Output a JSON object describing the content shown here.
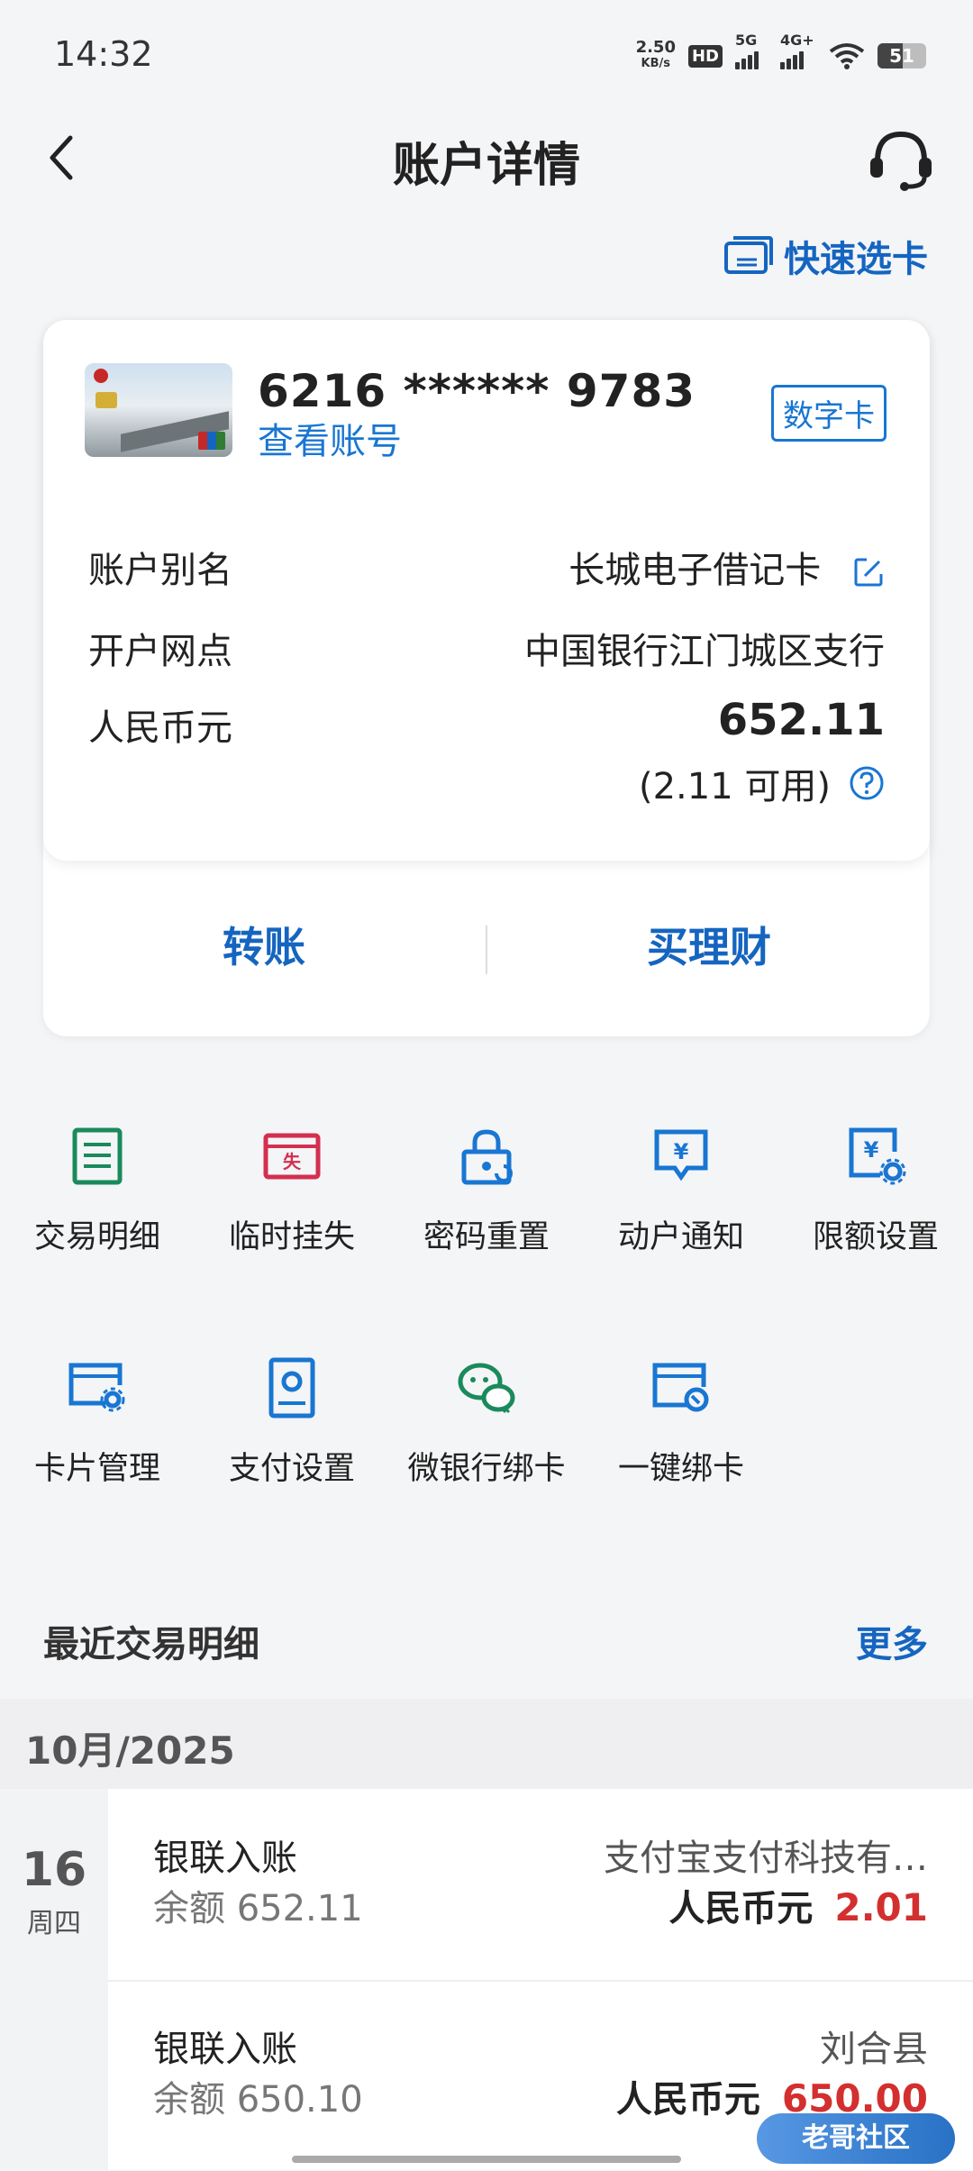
{
  "status_bar": {
    "time": "14:32",
    "net_speed_value": "2.50",
    "net_speed_unit": "KB/s",
    "hd_label": "HD",
    "signal1_label": "5G",
    "signal2_label": "4G+",
    "battery": "51",
    "battery_level": 0.51
  },
  "header": {
    "title": "账户详情",
    "back_icon": "chevron-left-icon",
    "service_icon": "headset-icon"
  },
  "quick_select": {
    "label": "快速选卡",
    "icon": "card-switch-icon"
  },
  "card": {
    "number": "6216 ****** 9783",
    "view_account": "查看账号",
    "badge": "数字卡",
    "alias_label": "账户别名",
    "alias_value": "长城电子借记卡",
    "branch_label": "开户网点",
    "branch_value": "中国银行江门城区支行",
    "currency_label": "人民币元",
    "balance": "652.11",
    "available": "(2.11 可用)"
  },
  "actions": {
    "transfer": "转账",
    "buy_wealth": "买理财"
  },
  "functions": [
    {
      "label": "交易明细",
      "icon": "transaction-list-icon",
      "color": "#1a8a5c"
    },
    {
      "label": "临时挂失",
      "icon": "report-loss-icon",
      "color": "#d32f4f"
    },
    {
      "label": "密码重置",
      "icon": "lock-reset-icon",
      "color": "#1976d2"
    },
    {
      "label": "动户通知",
      "icon": "yuan-notify-icon",
      "color": "#1976d2"
    },
    {
      "label": "限额设置",
      "icon": "limit-settings-icon",
      "color": "#1976d2"
    },
    {
      "label": "卡片管理",
      "icon": "card-manage-icon",
      "color": "#1976d2"
    },
    {
      "label": "支付设置",
      "icon": "payment-settings-icon",
      "color": "#1976d2"
    },
    {
      "label": "微银行绑卡",
      "icon": "wechat-bind-icon",
      "color": "#1a8a5c"
    },
    {
      "label": "一键绑卡",
      "icon": "one-click-bind-icon",
      "color": "#1976d2"
    }
  ],
  "recent": {
    "title": "最近交易明细",
    "more": "更多",
    "month": "10月/2025",
    "day": "16",
    "weekday": "周四",
    "transactions": [
      {
        "title": "银联入账",
        "balance": "余额  652.11",
        "party": "支付宝支付科技有…",
        "currency": "人民币元",
        "amount": "2.01"
      },
      {
        "title": "银联入账",
        "balance": "余额  650.10",
        "party": "刘合县",
        "currency": "人民币元",
        "amount": "650.00"
      }
    ]
  },
  "watermark": "老哥社区",
  "colors": {
    "accent": "#1565c0",
    "amount_red": "#d32f2f",
    "green": "#1a8a5c"
  }
}
